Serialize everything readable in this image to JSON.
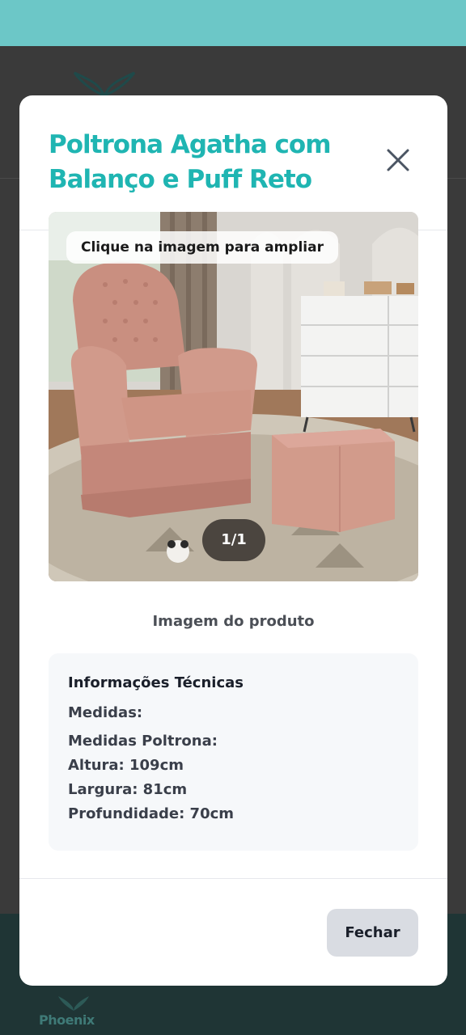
{
  "background": {
    "brand_name": "Phoenix",
    "colors": {
      "topbar": "#6cc7c7",
      "footer": "#1f3535"
    }
  },
  "modal": {
    "title_line1": "Poltrona Agatha com",
    "title_line2": "Balanço e Puff Reto",
    "close_icon": "x-icon",
    "image": {
      "zoom_hint": "Clique na imagem para ampliar",
      "counter": "1/1"
    },
    "caption": "Imagem do produto",
    "info": {
      "heading": "Informações Técnicas",
      "label": "Medidas:",
      "lines": [
        "Medidas Poltrona:",
        "Altura: 109cm",
        "Largura: 81cm",
        "Profundidade: 70cm"
      ]
    },
    "close_button": "Fechar",
    "colors": {
      "title": "#1fb5b2",
      "button_bg": "#d9dce2"
    }
  }
}
